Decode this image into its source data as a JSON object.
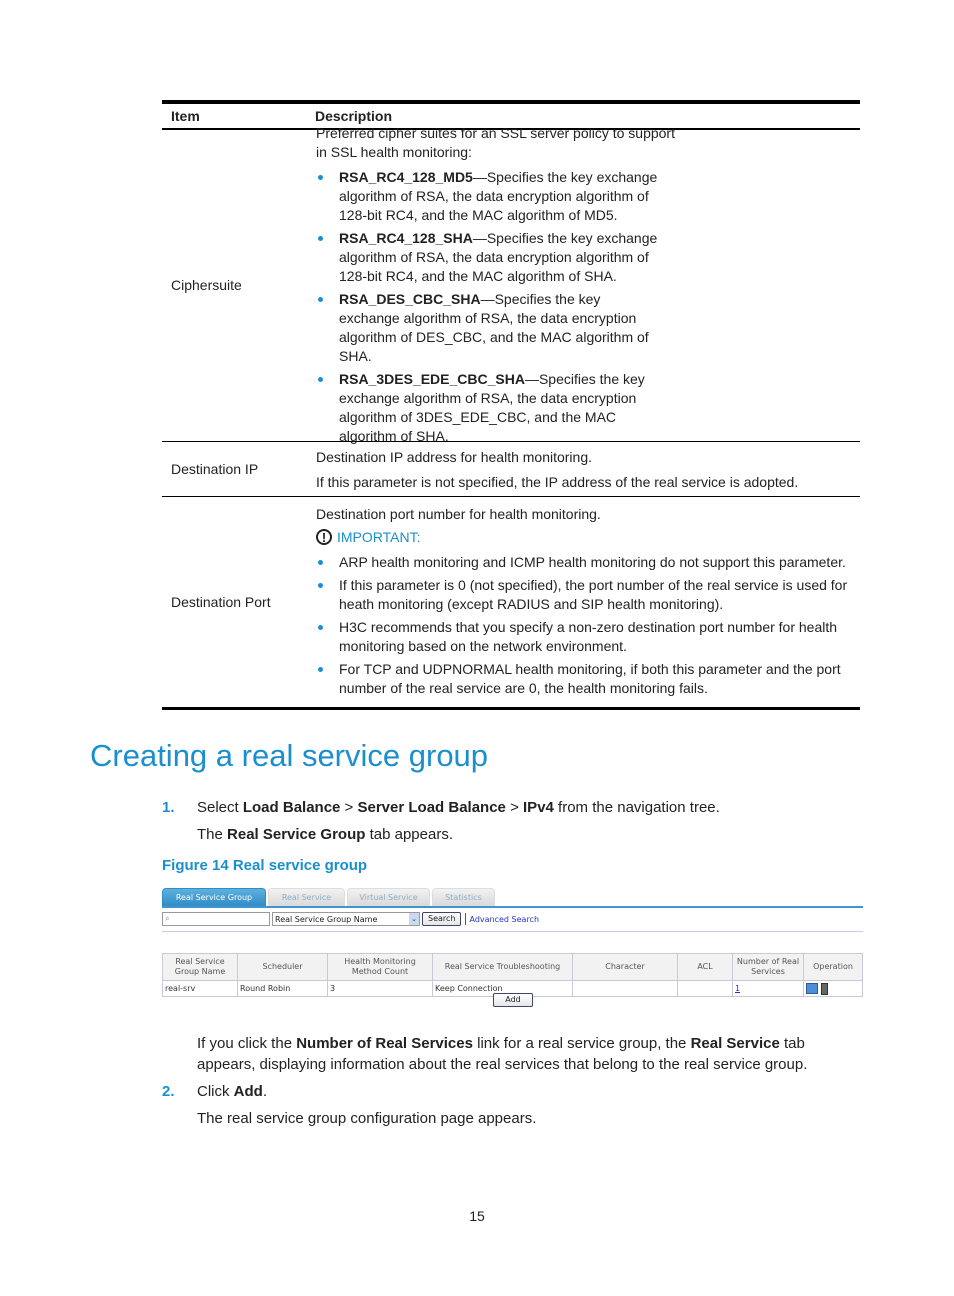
{
  "param_table": {
    "headers": [
      "Item",
      "Description"
    ],
    "rows": [
      {
        "item": "Ciphersuite",
        "intro": "Preferred cipher suites for an SSL server policy to support in SSL health monitoring:",
        "bullets": [
          {
            "term": "RSA_RC4_128_MD5",
            "text": "—Specifies the key exchange algorithm of RSA, the data encryption algorithm of 128-bit RC4, and the MAC algorithm of MD5."
          },
          {
            "term": "RSA_RC4_128_SHA",
            "text": "—Specifies the key exchange algorithm of RSA, the data encryption algorithm of 128-bit RC4, and the MAC algorithm of SHA."
          },
          {
            "term": "RSA_DES_CBC_SHA",
            "text": "—Specifies the key exchange algorithm of RSA, the data encryption algorithm of DES_CBC, and the MAC algorithm of SHA."
          },
          {
            "term": "RSA_3DES_EDE_CBC_SHA",
            "text": "—Specifies the key exchange algorithm of RSA, the data encryption algorithm of 3DES_EDE_CBC, and the MAC algorithm of SHA."
          }
        ]
      },
      {
        "item": "Destination IP",
        "lines": [
          "Destination IP address for health monitoring.",
          "If this parameter is not specified, the IP address of the real service is adopted."
        ]
      },
      {
        "item": "Destination Port",
        "intro": "Destination port number for health monitoring.",
        "important_label": "IMPORTANT:",
        "important_icon": "exclamation-circle-icon",
        "bullets": [
          "ARP health monitoring and ICMP health monitoring do not support this parameter.",
          "If this parameter is 0 (not specified), the port number of the real service is used for heath monitoring (except RADIUS and SIP health monitoring).",
          "H3C recommends that you specify a non-zero destination port number for health monitoring based on the network environment.",
          "For TCP and UDPNORMAL health monitoring, if both this parameter and the port number of the real service are 0, the health monitoring fails."
        ]
      }
    ]
  },
  "section": {
    "title": "Creating a real service group",
    "step1": {
      "num": "1.",
      "pre": "Select ",
      "b1": "Load Balance",
      "s1": " > ",
      "b2": "Server Load Balance",
      "s2": " > ",
      "b3": "IPv4",
      "post": " from the navigation tree."
    },
    "step1_result": {
      "pre": "The ",
      "bold": "Real Service Group",
      "post": " tab appears."
    },
    "figure_caption": "Figure 14 Real service group",
    "para": {
      "pre": "If you click the ",
      "b1": "Number of Real Services",
      "mid": " link for a real service group, the ",
      "b2": "Real Service",
      "post": " tab appears, displaying information about the real services that belong to the real service group."
    },
    "step2": {
      "num": "2.",
      "pre": "Click ",
      "bold": "Add",
      "post": "."
    },
    "step2_result": "The real service group configuration page appears."
  },
  "ui": {
    "tabs": [
      "Real Service Group",
      "Real Service",
      "Virtual Service",
      "Statistics"
    ],
    "search_value": "",
    "search_field": "Real Service Group Name",
    "search_button": "Search",
    "advanced_search": "Advanced Search",
    "table_headers": [
      "Real Service Group Name",
      "Scheduler",
      "Health Monitoring Method Count",
      "Real Service Troubleshooting",
      "Character",
      "ACL",
      "Number of Real Services",
      "Operation"
    ],
    "rows": [
      {
        "name": "real-srv",
        "scheduler": "Round Robin",
        "hm_count": "3",
        "troubleshooting": "Keep Connection",
        "character": "",
        "acl": "",
        "num_real_services": "1"
      }
    ],
    "add_button": "Add",
    "accent": "#3d96cf"
  },
  "page_number": "15",
  "colors": {
    "heading_blue": "#1a8fd0"
  }
}
